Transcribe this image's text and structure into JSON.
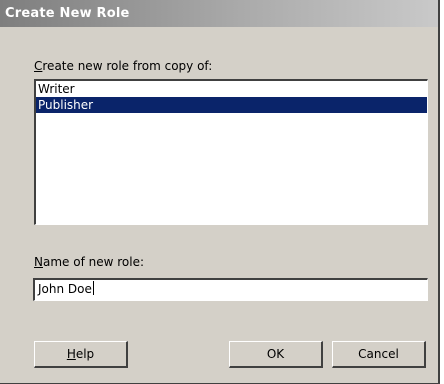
{
  "window": {
    "title": "Create New Role"
  },
  "copy_from": {
    "label_hotkey": "C",
    "label_rest": "reate new role from copy of:",
    "items": [
      {
        "label": "Writer",
        "selected": false
      },
      {
        "label": "Publisher",
        "selected": true
      }
    ]
  },
  "new_role": {
    "label_hotkey": "N",
    "label_rest": "ame of new role:",
    "value": "John Doe"
  },
  "buttons": {
    "help_hotkey": "H",
    "help_rest": "elp",
    "ok_label": "OK",
    "cancel_label": "Cancel"
  },
  "colors": {
    "dialog_bg": "#d4d0c8",
    "selection_bg": "#0a246a",
    "selection_text": "#ffffff"
  }
}
